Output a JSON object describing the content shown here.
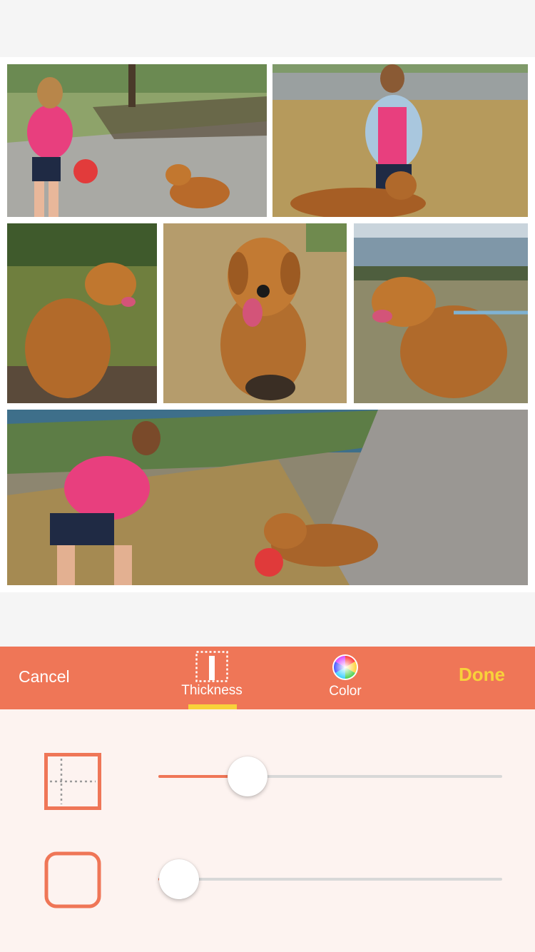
{
  "toolbar": {
    "cancel_label": "Cancel",
    "done_label": "Done",
    "tabs": [
      {
        "label": "Thickness",
        "icon": "thickness-icon",
        "selected": true
      },
      {
        "label": "Color",
        "icon": "color-wheel-icon",
        "selected": false
      }
    ]
  },
  "sliders": {
    "inner_spacing": {
      "icon": "inner-spacing-icon",
      "value": 0.26
    },
    "corner_radius": {
      "icon": "corner-radius-icon",
      "value": 0.06
    }
  },
  "collage": {
    "photos": [
      {
        "icon": "photo-woman-pink-shirt-ball-dog"
      },
      {
        "icon": "photo-woman-denim-shirt-dog"
      },
      {
        "icon": "photo-dog-sitting-profile"
      },
      {
        "icon": "photo-dog-sitting-front"
      },
      {
        "icon": "photo-dog-on-leash-shore"
      },
      {
        "icon": "photo-woman-dog-ball-path"
      }
    ]
  },
  "colors": {
    "accent": "#ef7657",
    "done": "#f8d23a",
    "panel": "#fdf3f0",
    "track": "#d8d8d8"
  }
}
